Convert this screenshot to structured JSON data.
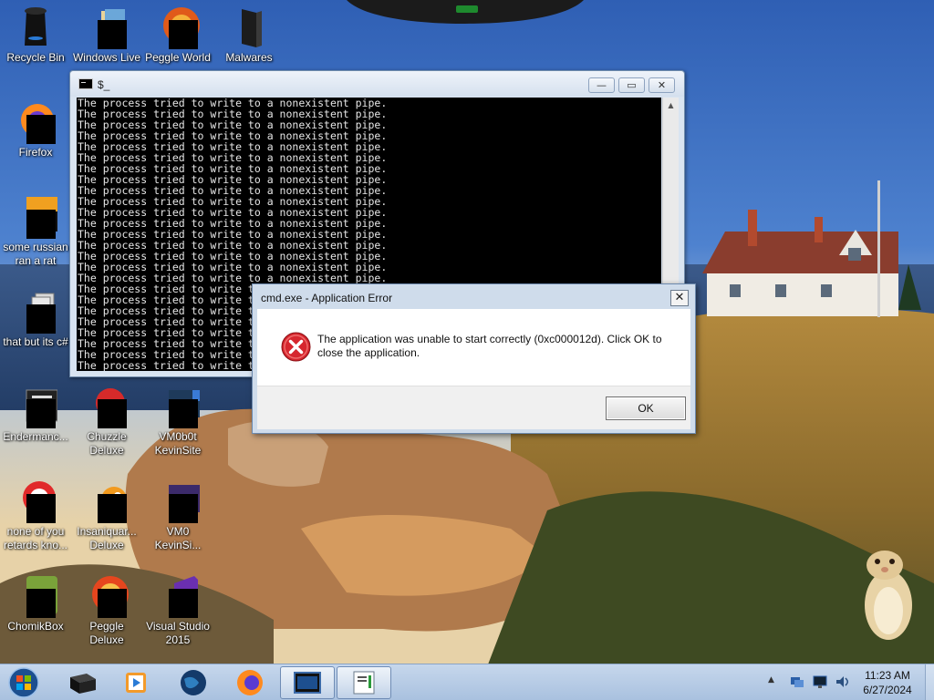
{
  "desktop": {
    "icons": [
      {
        "label": "Recycle Bin",
        "icon": "recycle-bin-icon"
      },
      {
        "label": "Windows Live",
        "icon": "windows-live-icon"
      },
      {
        "label": "Peggle World",
        "icon": "peggle-world-icon"
      },
      {
        "label": "Malwares",
        "icon": "malwares-icon"
      },
      {
        "label": "Firefox",
        "icon": "firefox-icon"
      },
      {
        "label": "some russian ran a rat",
        "icon": "shortcut-icon"
      },
      {
        "label": "that but its c#",
        "icon": "shortcut-icon"
      },
      {
        "label": "Endermanc...",
        "icon": "program-icon"
      },
      {
        "label": "Chuzzle Deluxe",
        "icon": "chuzzle-icon"
      },
      {
        "label": "VM0b0t KevinSite",
        "icon": "vm-icon"
      },
      {
        "label": "none of you retards kno...",
        "icon": "shortcut-icon"
      },
      {
        "label": "Insaniquar... Deluxe",
        "icon": "insaniquarium-icon"
      },
      {
        "label": "VM0 KevinSi...",
        "icon": "vm-icon"
      },
      {
        "label": "ChomikBox",
        "icon": "chomikbox-icon"
      },
      {
        "label": "Peggle Deluxe",
        "icon": "peggle-deluxe-icon"
      },
      {
        "label": "Visual Studio 2015",
        "icon": "visual-studio-icon"
      }
    ]
  },
  "console": {
    "title": "$_",
    "lines": [
      "The process tried to write to a nonexistent pipe.",
      "The process tried to write to a nonexistent pipe.",
      "The process tried to write to a nonexistent pipe.",
      "The process tried to write to a nonexistent pipe.",
      "The process tried to write to a nonexistent pipe.",
      "The process tried to write to a nonexistent pipe.",
      "The process tried to write to a nonexistent pipe.",
      "The process tried to write to a nonexistent pipe.",
      "The process tried to write to a nonexistent pipe.",
      "The process tried to write to a nonexistent pipe.",
      "The process tried to write to a nonexistent pipe.",
      "The process tried to write to a nonexistent pipe.",
      "The process tried to write to a nonexistent pipe.",
      "The process tried to write to a nonexistent pipe.",
      "The process tried to write to a nonexistent pipe.",
      "The process tried to write to a nonexistent pipe.",
      "The process tried to write to a nonexistent pipe.",
      "The process tried to write to a nonexistent pipe.",
      "The process tried to write to a nonexistent pipe.",
      "The process tried to write to a nonexistent pipe.",
      "The process tried to write to a nonexistent pipe.",
      "The process tried to write to a nonexistent pipe.",
      "The process tried to write to a nonexistent pipe.",
      "The process tried to write to a nonexistent pipe.",
      "The process tried to write to a nonexistent pipe."
    ],
    "minimize_glyph": "—",
    "maximize_glyph": "▭",
    "close_glyph": "✕"
  },
  "dialog": {
    "title": "cmd.exe - Application Error",
    "message": "The application was unable to start correctly (0xc000012d). Click OK to close the application.",
    "ok_label": "OK",
    "close_glyph": "✕"
  },
  "taskbar": {
    "time": "11:23 AM",
    "date": "6/27/2024",
    "tray_arrow": "▲",
    "pinned": [
      "start-orb-icon",
      "console-app-icon",
      "media-player-icon",
      "globe-icon",
      "firefox-icon",
      "command-prompt-icon",
      "notepad-icon"
    ]
  },
  "colors": {
    "sky": "#4a78c4",
    "console_bg": "#000000",
    "console_text": "#e6e6e6",
    "error_red": "#d6262e",
    "taskbar": "#b8cde6"
  }
}
